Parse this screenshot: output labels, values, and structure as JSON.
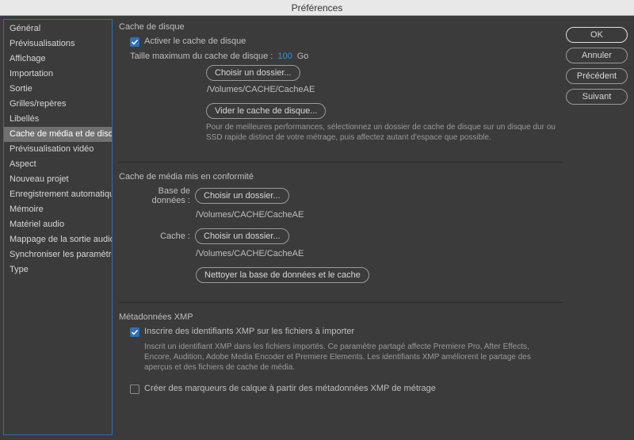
{
  "title": "Préférences",
  "sidebar": {
    "items": [
      {
        "label": "Général"
      },
      {
        "label": "Prévisualisations"
      },
      {
        "label": "Affichage"
      },
      {
        "label": "Importation"
      },
      {
        "label": "Sortie"
      },
      {
        "label": "Grilles/repères"
      },
      {
        "label": "Libellés"
      },
      {
        "label": "Cache de média et de disque",
        "selected": true
      },
      {
        "label": "Prévisualisation vidéo"
      },
      {
        "label": "Aspect"
      },
      {
        "label": "Nouveau projet"
      },
      {
        "label": "Enregistrement automatique"
      },
      {
        "label": "Mémoire"
      },
      {
        "label": "Matériel audio"
      },
      {
        "label": "Mappage de la sortie audio"
      },
      {
        "label": "Synchroniser les paramètres"
      },
      {
        "label": "Type"
      }
    ]
  },
  "buttons": {
    "ok": "OK",
    "cancel": "Annuler",
    "prev": "Précédent",
    "next": "Suivant"
  },
  "diskCache": {
    "title": "Cache de disque",
    "enableLabel": "Activer le cache de disque",
    "enableChecked": true,
    "maxSizeLabel": "Taille maximum du cache de disque :",
    "maxSizeValue": "100",
    "maxSizeUnit": "Go",
    "chooseFolder": "Choisir un dossier...",
    "path": "/Volumes/CACHE/CacheAE",
    "empty": "Vider le cache de disque...",
    "note": "Pour de meilleures performances, sélectionnez un dossier de cache de disque sur un disque dur ou SSD rapide distinct de votre métrage, puis affectez autant d'espace que possible."
  },
  "mediaCache": {
    "title": "Cache de média mis en conformité",
    "dbLabel": "Base de données :",
    "dbChoose": "Choisir un dossier...",
    "dbPath": "/Volumes/CACHE/CacheAE",
    "cacheLabel": "Cache :",
    "cacheChoose": "Choisir un dossier...",
    "cachePath": "/Volumes/CACHE/CacheAE",
    "clean": "Nettoyer la base de données et le cache"
  },
  "xmp": {
    "title": "Métadonnées XMP",
    "writeIdsLabel": "Inscrire des identifiants XMP sur les fichiers à importer",
    "writeIdsChecked": true,
    "writeIdsNote": "Inscrit un identifiant XMP dans les fichiers importés. Ce paramètre partagé affecte Premiere Pro, After Effects, Encore, Audition, Adobe Media Encoder et Premiere Elements. Les identifiants XMP améliorent le partage des aperçus et des fichiers de cache de média.",
    "createMarkersLabel": "Créer des marqueurs de calque à partir des métadonnées XMP de métrage",
    "createMarkersChecked": false
  }
}
